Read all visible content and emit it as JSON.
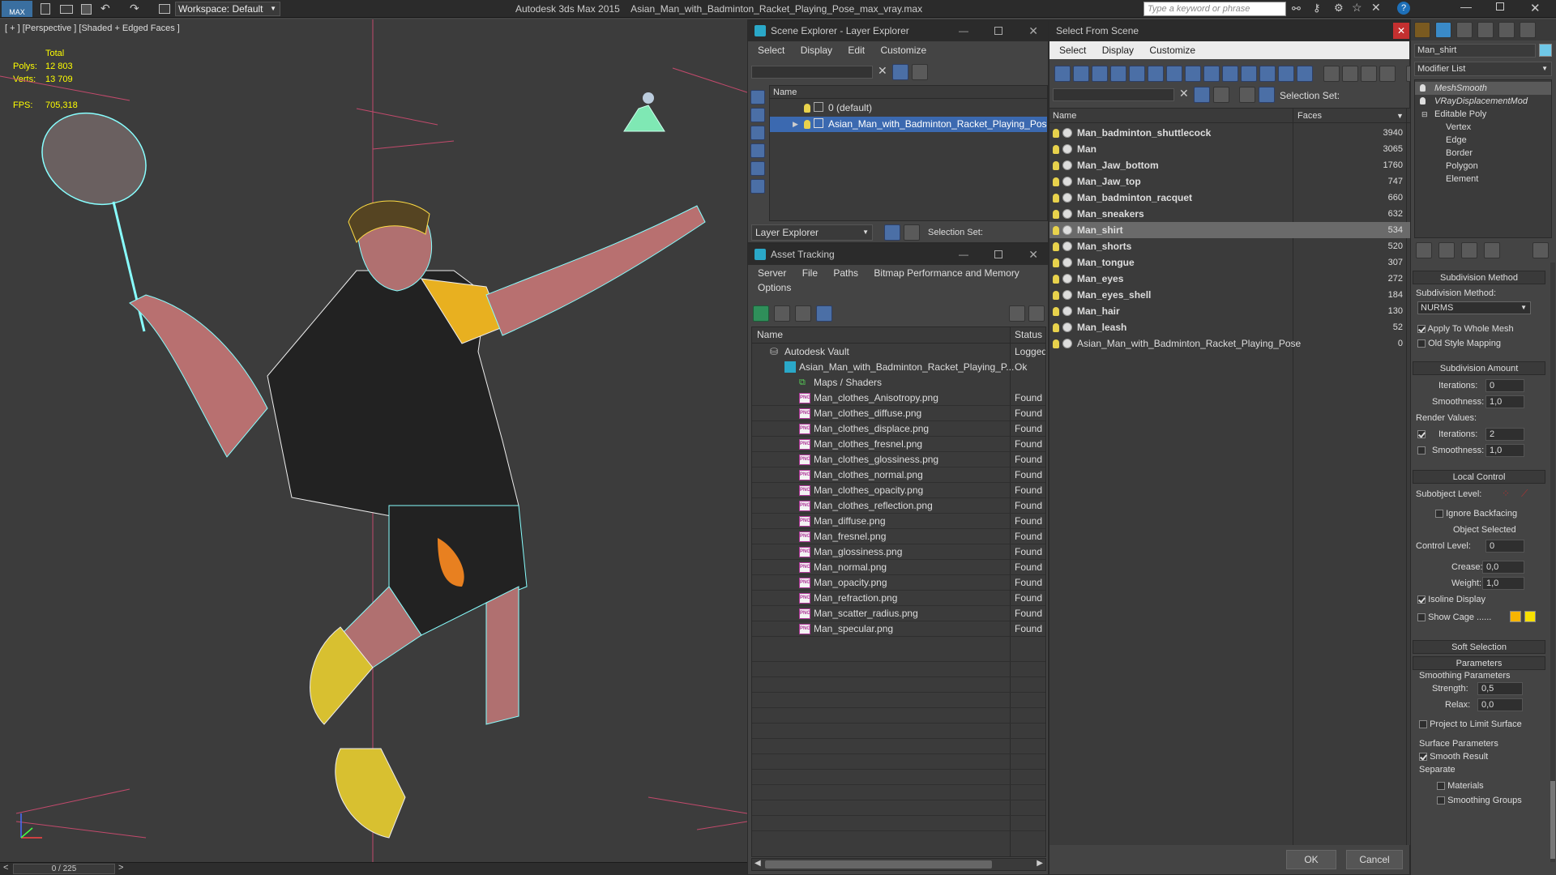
{
  "titlebar": {
    "app_title": "Autodesk 3ds Max  2015",
    "file_title": "Asian_Man_with_Badminton_Racket_Playing_Pose_max_vray.max",
    "workspace": "Workspace: Default",
    "search_placeholder": "Type a keyword or phrase",
    "max_label": "MAX"
  },
  "viewport": {
    "label": "[ + ] [Perspective ] [Shaded + Edged Faces ]",
    "stats_total": "Total",
    "polys_label": "Polys:",
    "polys_value": "12 803",
    "verts_label": "Verts:",
    "verts_value": "13 709",
    "fps_label": "FPS:",
    "fps_value": "705,318"
  },
  "timebar": {
    "frame": "0 / 225",
    "prev": "<",
    "next": ">"
  },
  "scene_explorer": {
    "title": "Scene Explorer - Layer Explorer",
    "menu": [
      "Select",
      "Display",
      "Edit",
      "Customize"
    ],
    "col_name": "Name",
    "layers": [
      "0 (default)",
      "Asian_Man_with_Badminton_Racket_Playing_Pose"
    ],
    "footer_dropdown": "Layer Explorer",
    "selection_set": "Selection Set:"
  },
  "asset_tracking": {
    "title": "Asset Tracking",
    "menu1": [
      "Server",
      "File",
      "Paths",
      "Bitmap Performance and Memory"
    ],
    "menu2": "Options",
    "col_name": "Name",
    "col_status": "Status",
    "vault": {
      "name": "Autodesk Vault",
      "status": "Logged"
    },
    "file": {
      "name": "Asian_Man_with_Badminton_Racket_Playing_P...",
      "status": "Ok"
    },
    "folder": "Maps / Shaders",
    "maps": [
      {
        "name": "Man_clothes_Anisotropy.png",
        "status": "Found"
      },
      {
        "name": "Man_clothes_diffuse.png",
        "status": "Found"
      },
      {
        "name": "Man_clothes_displace.png",
        "status": "Found"
      },
      {
        "name": "Man_clothes_fresnel.png",
        "status": "Found"
      },
      {
        "name": "Man_clothes_glossiness.png",
        "status": "Found"
      },
      {
        "name": "Man_clothes_normal.png",
        "status": "Found"
      },
      {
        "name": "Man_clothes_opacity.png",
        "status": "Found"
      },
      {
        "name": "Man_clothes_reflection.png",
        "status": "Found"
      },
      {
        "name": "Man_diffuse.png",
        "status": "Found"
      },
      {
        "name": "Man_fresnel.png",
        "status": "Found"
      },
      {
        "name": "Man_glossiness.png",
        "status": "Found"
      },
      {
        "name": "Man_normal.png",
        "status": "Found"
      },
      {
        "name": "Man_opacity.png",
        "status": "Found"
      },
      {
        "name": "Man_refraction.png",
        "status": "Found"
      },
      {
        "name": "Man_scatter_radius.png",
        "status": "Found"
      },
      {
        "name": "Man_specular.png",
        "status": "Found"
      }
    ]
  },
  "select_from_scene": {
    "title": "Select From Scene",
    "menu": [
      "Select",
      "Display",
      "Customize"
    ],
    "selection_set": "Selection Set:",
    "col_name": "Name",
    "col_faces": "Faces",
    "objects": [
      {
        "name": "Man_badminton_shuttlecock",
        "faces": "3940"
      },
      {
        "name": "Man",
        "faces": "3065"
      },
      {
        "name": "Man_Jaw_bottom",
        "faces": "1760"
      },
      {
        "name": "Man_Jaw_top",
        "faces": "747"
      },
      {
        "name": "Man_badminton_racquet",
        "faces": "660"
      },
      {
        "name": "Man_sneakers",
        "faces": "632"
      },
      {
        "name": "Man_shirt",
        "faces": "534"
      },
      {
        "name": "Man_shorts",
        "faces": "520"
      },
      {
        "name": "Man_tongue",
        "faces": "307"
      },
      {
        "name": "Man_eyes",
        "faces": "272"
      },
      {
        "name": "Man_eyes_shell",
        "faces": "184"
      },
      {
        "name": "Man_hair",
        "faces": "130"
      },
      {
        "name": "Man_leash",
        "faces": "52"
      },
      {
        "name": "Asian_Man_with_Badminton_Racket_Playing_Pose",
        "faces": "0"
      }
    ],
    "ok": "OK",
    "cancel": "Cancel"
  },
  "command_panel": {
    "object_name": "Man_shirt",
    "modifier_list": "Modifier List",
    "stack": [
      "MeshSmooth",
      "VRayDisplacementMod",
      "Editable Poly",
      "Vertex",
      "Edge",
      "Border",
      "Polygon",
      "Element"
    ],
    "subdivision_method_hdr": "Subdivision Method",
    "subdivision_method_lbl": "Subdivision Method:",
    "subdivision_method_val": "NURMS",
    "apply_whole_mesh": "Apply To Whole Mesh",
    "old_style_mapping": "Old Style Mapping",
    "subdivision_amount_hdr": "Subdivision Amount",
    "iterations_lbl": "Iterations:",
    "iterations_val": "0",
    "smoothness_lbl": "Smoothness:",
    "smoothness_val": "1,0",
    "render_values": "Render Values:",
    "r_iterations_lbl": "Iterations:",
    "r_iterations_val": "2",
    "r_smoothness_lbl": "Smoothness:",
    "r_smoothness_val": "1,0",
    "local_control_hdr": "Local Control",
    "subobject_level": "Subobject Level:",
    "ignore_backfacing": "Ignore Backfacing",
    "object_selected": "Object Selected",
    "control_level_lbl": "Control Level:",
    "control_level_val": "0",
    "crease_lbl": "Crease:",
    "crease_val": "0,0",
    "weight_lbl": "Weight:",
    "weight_val": "1,0",
    "isoline_display": "Isoline Display",
    "show_cage": "Show Cage ......",
    "soft_selection_hdr": "Soft Selection",
    "parameters_hdr": "Parameters",
    "smoothing_parameters": "Smoothing Parameters",
    "strength_lbl": "Strength:",
    "strength_val": "0,5",
    "relax_lbl": "Relax:",
    "relax_val": "0,0",
    "project_limit": "Project to Limit Surface",
    "surface_parameters": "Surface Parameters",
    "smooth_result": "Smooth Result",
    "separate": "Separate",
    "materials": "Materials",
    "smoothing_groups": "Smoothing Groups"
  }
}
